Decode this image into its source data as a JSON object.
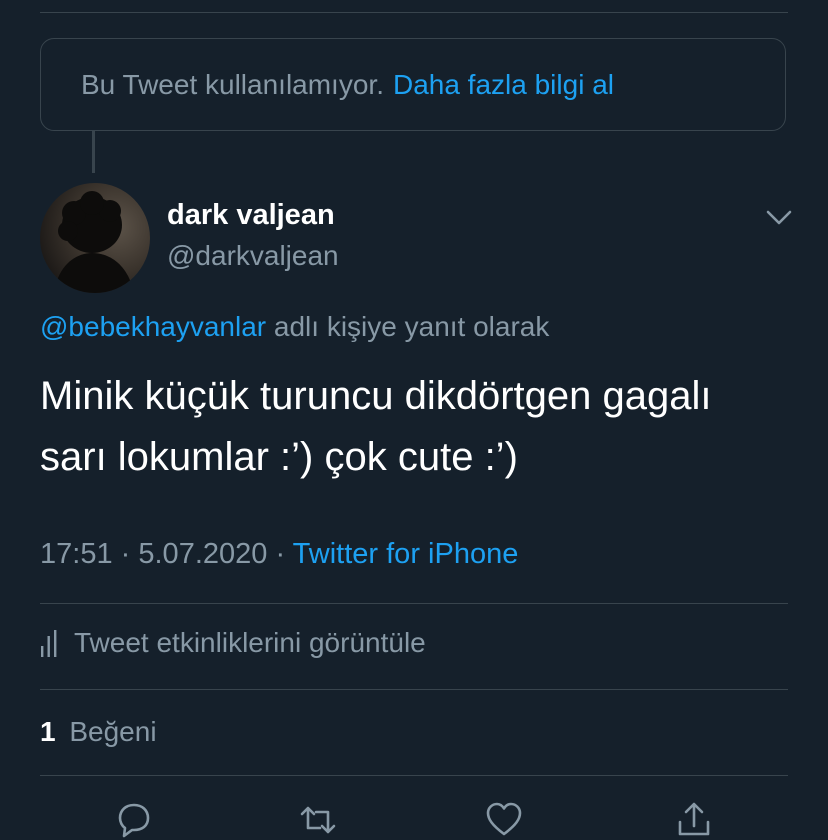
{
  "unavailable_notice": {
    "text": "Bu Tweet kullanılamıyor.",
    "link": "Daha fazla bilgi al"
  },
  "author": {
    "name": "dark valjean",
    "handle": "@darkvaljean"
  },
  "reply_context": {
    "mention": "@bebekhayvanlar",
    "suffix": "adlı kişiye yanıt olarak"
  },
  "tweet": {
    "line1": "Minik küçük turuncu dikdörtgen gagalı",
    "line2": "sarı lokumlar :’) çok cute :’)"
  },
  "meta": {
    "time": "17:51",
    "separator1": "·",
    "date": "5.07.2020",
    "separator2": "·",
    "source": "Twitter for iPhone"
  },
  "activity": {
    "label": "Tweet etkinliklerini görüntüle"
  },
  "likes": {
    "count": "1",
    "label": "Beğeni"
  },
  "icons": {
    "chevron": "chevron-down-icon",
    "analytics": "analytics-bars-icon",
    "reply": "reply-icon",
    "retweet": "retweet-icon",
    "like": "heart-icon",
    "share": "share-icon"
  },
  "colors": {
    "background": "#15202b",
    "accent": "#1da1f2",
    "muted": "#8899a6",
    "border": "#38444d"
  }
}
